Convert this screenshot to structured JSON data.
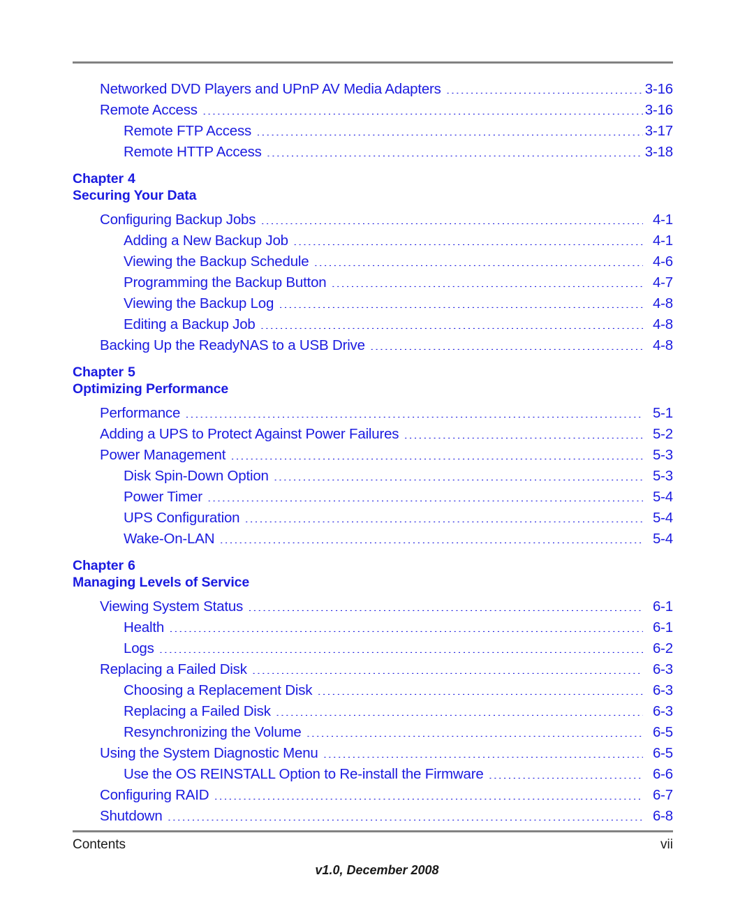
{
  "document": {
    "footer": {
      "left_label": "Contents",
      "page_number": "vii",
      "version_line": "v1.0, December 2008"
    },
    "colors": {
      "link_blue": "#1b1be0",
      "rule_gray": "#828282",
      "footer_text": "#1a1a1a"
    }
  },
  "toc": {
    "blocks": [
      {
        "type": "entries",
        "entries": [
          {
            "level": 1,
            "title": "Networked DVD Players and UPnP AV Media Adapters",
            "page": "3-16"
          },
          {
            "level": 1,
            "title": "Remote Access",
            "page": "3-16"
          },
          {
            "level": 2,
            "title": "Remote FTP Access",
            "page": "3-17"
          },
          {
            "level": 2,
            "title": "Remote HTTP Access",
            "page": "3-18"
          }
        ]
      },
      {
        "type": "chapter",
        "chapter_label": "Chapter",
        "chapter_number": "4",
        "chapter_title": "Securing Your Data",
        "entries": [
          {
            "level": 1,
            "title": "Configuring Backup Jobs",
            "page": "4-1"
          },
          {
            "level": 2,
            "title": "Adding a New Backup Job",
            "page": "4-1"
          },
          {
            "level": 2,
            "title": "Viewing the Backup Schedule",
            "page": "4-6"
          },
          {
            "level": 2,
            "title": "Programming the Backup Button",
            "page": "4-7"
          },
          {
            "level": 2,
            "title": "Viewing the Backup Log",
            "page": "4-8"
          },
          {
            "level": 2,
            "title": "Editing a Backup Job",
            "page": "4-8"
          },
          {
            "level": 1,
            "title": "Backing Up the ReadyNAS to a USB Drive",
            "page": "4-8"
          }
        ]
      },
      {
        "type": "chapter",
        "chapter_label": "Chapter",
        "chapter_number": "5",
        "chapter_title": "Optimizing Performance",
        "entries": [
          {
            "level": 1,
            "title": "Performance",
            "page": "5-1"
          },
          {
            "level": 1,
            "title": "Adding a UPS to Protect Against Power Failures",
            "page": "5-2"
          },
          {
            "level": 1,
            "title": "Power Management",
            "page": "5-3"
          },
          {
            "level": 2,
            "title": "Disk Spin-Down Option",
            "page": "5-3"
          },
          {
            "level": 2,
            "title": "Power Timer",
            "page": "5-4"
          },
          {
            "level": 2,
            "title": "UPS Configuration",
            "page": "5-4"
          },
          {
            "level": 2,
            "title": "Wake-On-LAN",
            "page": "5-4"
          }
        ]
      },
      {
        "type": "chapter",
        "chapter_label": "Chapter",
        "chapter_number": "6",
        "chapter_title": "Managing Levels of Service",
        "entries": [
          {
            "level": 1,
            "title": "Viewing System Status",
            "page": "6-1"
          },
          {
            "level": 2,
            "title": "Health",
            "page": "6-1"
          },
          {
            "level": 2,
            "title": "Logs",
            "page": "6-2"
          },
          {
            "level": 1,
            "title": "Replacing a Failed Disk",
            "page": "6-3"
          },
          {
            "level": 2,
            "title": "Choosing a Replacement Disk",
            "page": "6-3"
          },
          {
            "level": 2,
            "title": "Replacing a Failed Disk",
            "page": "6-3"
          },
          {
            "level": 2,
            "title": "Resynchronizing the Volume",
            "page": "6-5"
          },
          {
            "level": 1,
            "title": "Using the System Diagnostic Menu",
            "page": "6-5"
          },
          {
            "level": 2,
            "title": "Use the OS REINSTALL Option to Re-install the Firmware",
            "page": "6-6"
          },
          {
            "level": 1,
            "title": "Configuring RAID",
            "page": "6-7"
          },
          {
            "level": 1,
            "title": "Shutdown",
            "page": "6-8"
          }
        ]
      }
    ]
  }
}
